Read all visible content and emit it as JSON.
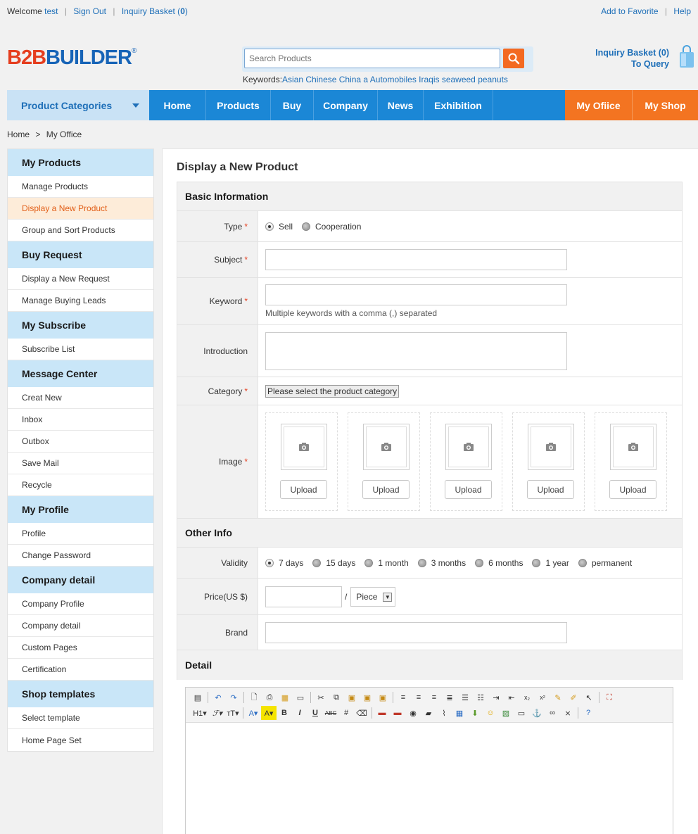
{
  "topbar": {
    "welcome": "Welcome",
    "user": "test",
    "sign_out": "Sign Out",
    "inquiry": "Inquiry Basket (",
    "inquiry_count": "0",
    "inquiry_close": ")",
    "add_favorite": "Add to Favorite",
    "help": "Help"
  },
  "header": {
    "logo_a": "B",
    "logo_b": "2",
    "logo_c": "B",
    "logo_d": "BUILDER",
    "logo_mark": "®",
    "search_placeholder": "Search Products",
    "keywords_label": "Keywords:",
    "keywords": "Asian Chinese China a Automobiles Iraqis seaweed peanuts",
    "basket_title": "Inquiry Basket (0)",
    "basket_link": "To Query"
  },
  "nav": {
    "categories": "Product Categories",
    "items": [
      "Home",
      "Products",
      "Buy",
      "Company",
      "News",
      "Exhibition"
    ],
    "right": [
      "My Ofiice",
      "My Shop"
    ]
  },
  "breadcrumb": {
    "home": "Home",
    "sep": ">",
    "current": "My Office"
  },
  "sidebar": {
    "groups": [
      {
        "title": "My Products",
        "items": [
          "Manage Products",
          "Display a New Product",
          "Group and Sort Products"
        ]
      },
      {
        "title": "Buy Request",
        "items": [
          "Display a New Request",
          "Manage Buying Leads"
        ]
      },
      {
        "title": "My Subscribe",
        "items": [
          "Subscribe List"
        ]
      },
      {
        "title": "Message Center",
        "items": [
          "Creat New",
          "Inbox",
          "Outbox",
          "Save Mail",
          "Recycle"
        ]
      },
      {
        "title": "My Profile",
        "items": [
          "Profile",
          "Change Password"
        ]
      },
      {
        "title": "Company detail",
        "items": [
          "Company Profile",
          "Company detail",
          "Custom Pages",
          "Certification"
        ]
      },
      {
        "title": "Shop templates",
        "items": [
          "Select template",
          "Home Page Set"
        ]
      }
    ]
  },
  "main": {
    "title": "Display a New Product",
    "basic_info": "Basic Information",
    "type_label": "Type",
    "type_options": [
      "Sell",
      "Cooperation"
    ],
    "subject_label": "Subject",
    "keyword_label": "Keyword",
    "keyword_hint": "Multiple keywords with a comma (,) separated",
    "intro_label": "Introduction",
    "category_label": "Category",
    "category_button": "Please select the product category",
    "image_label": "Image",
    "upload_label": "Upload",
    "other_info": "Other Info",
    "validity_label": "Validity",
    "validity_options": [
      "7 days",
      "15 days",
      "1 month",
      "3 months",
      "6 months",
      "1 year",
      "permanent"
    ],
    "price_label": "Price(US $)",
    "price_sep": "/",
    "unit_value": "Piece",
    "brand_label": "Brand",
    "detail": "Detail",
    "required_mark": "*"
  },
  "colors": {
    "accent_blue": "#1b87d6",
    "accent_orange": "#f37421",
    "sidebar_head": "#c9e6f8",
    "active_item": "#fdecd9"
  }
}
